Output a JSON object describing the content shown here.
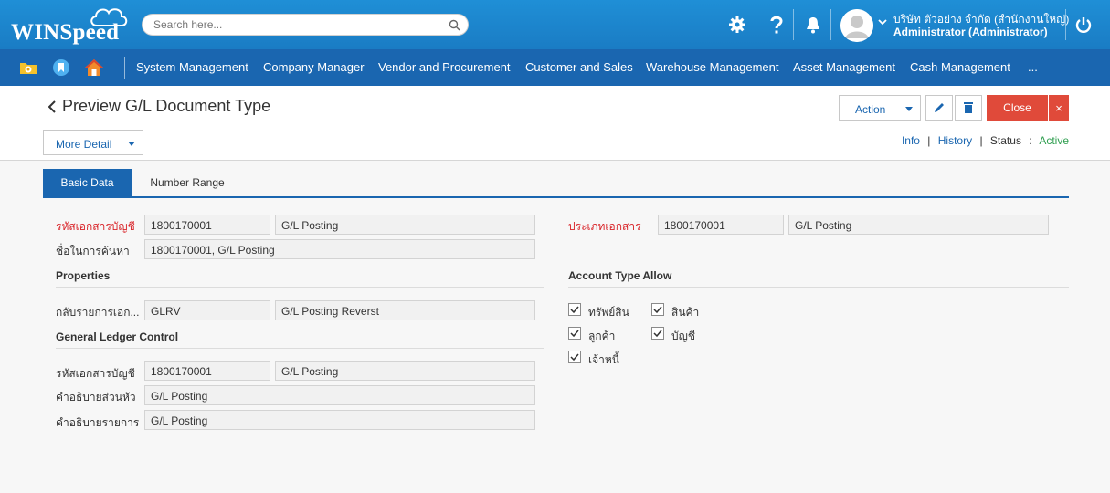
{
  "app": {
    "logo_text": "WINSpeed"
  },
  "search": {
    "placeholder": "Search here..."
  },
  "user": {
    "company": "บริษัท ตัวอย่าง จำกัด (สำนักงานใหญ่)",
    "role": "Administrator (Administrator)"
  },
  "menu": {
    "items": [
      "System Management",
      "Company Manager",
      "Vendor and Procurement",
      "Customer and Sales",
      "Warehouse Management",
      "Asset Management",
      "Cash Management",
      "..."
    ]
  },
  "header": {
    "title": "Preview G/L Document Type",
    "action_label": "Action",
    "close_label": "Close",
    "close_x": "×",
    "more_detail_label": "More Detail",
    "info_link": "Info",
    "history_link": "History",
    "status_label": "Status",
    "status_colon": ":",
    "status_value": "Active",
    "link_sep": "|"
  },
  "tabs": [
    {
      "label": "Basic Data",
      "active": true
    },
    {
      "label": "Number Range",
      "active": false
    }
  ],
  "basic": {
    "doc_code_label": "รหัสเอกสารบัญชี",
    "doc_code": "1800170001",
    "doc_code_name": "G/L Posting",
    "search_name_label": "ชื่อในการค้นหา",
    "search_name": "1800170001, G/L Posting",
    "doc_type_label": "ประเภทเอกสาร",
    "doc_type_code": "1800170001",
    "doc_type_name": "G/L Posting"
  },
  "properties": {
    "title": "Properties",
    "reverse_label": "กลับรายการเอก...",
    "reverse_code": "GLRV",
    "reverse_name": "G/L Posting Reverst"
  },
  "gl_control": {
    "title": "General Ledger Control",
    "doc_code_label": "รหัสเอกสารบัญชี",
    "doc_code": "1800170001",
    "doc_code_name": "G/L Posting",
    "header_desc_label": "คำอธิบายส่วนหัว",
    "header_desc": "G/L Posting",
    "line_desc_label": "คำอธิบายรายการ",
    "line_desc": "G/L Posting"
  },
  "account_type": {
    "title": "Account Type Allow",
    "items": [
      {
        "label": "ทรัพย์สิน",
        "checked": true
      },
      {
        "label": "สินค้า",
        "checked": true
      },
      {
        "label": "ลูกค้า",
        "checked": true
      },
      {
        "label": "บัญชี",
        "checked": true
      },
      {
        "label": "เจ้าหนี้",
        "checked": true
      }
    ]
  },
  "colors": {
    "topbar": "#1f8fd6",
    "menubar": "#1a66b0",
    "accent": "#1a66b0",
    "close": "#e04a3a",
    "required": "#d9262b",
    "status_active": "#2e9e4f"
  },
  "icons": {
    "top": [
      "gear-icon",
      "help-icon",
      "bell-icon",
      "avatar-icon",
      "power-icon"
    ],
    "menu": [
      "folder-icon",
      "bookmark-icon",
      "home-icon"
    ]
  }
}
